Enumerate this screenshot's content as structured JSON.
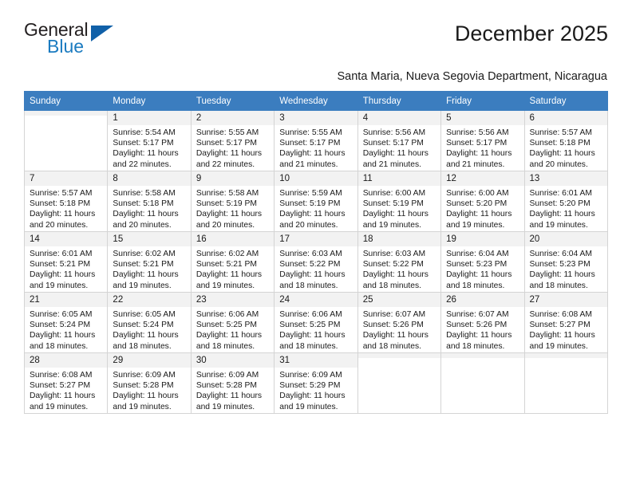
{
  "brand": {
    "name_top": "General",
    "name_bottom": "Blue",
    "triangle_color": "#1060a8",
    "blue_text_color": "#1b7bc0"
  },
  "header": {
    "title": "December 2025",
    "subtitle": "Santa Maria, Nueva Segovia Department, Nicaragua"
  },
  "theme": {
    "header_bg": "#3b7dbf",
    "daynum_bg": "#f2f2f2",
    "grid_border": "#d4d4d4"
  },
  "calendar": {
    "weekdays": [
      "Sunday",
      "Monday",
      "Tuesday",
      "Wednesday",
      "Thursday",
      "Friday",
      "Saturday"
    ],
    "weeks": [
      [
        {
          "day": "",
          "sunrise": "",
          "sunset": "",
          "daylight1": "",
          "daylight2": ""
        },
        {
          "day": "1",
          "sunrise": "Sunrise: 5:54 AM",
          "sunset": "Sunset: 5:17 PM",
          "daylight1": "Daylight: 11 hours",
          "daylight2": "and 22 minutes."
        },
        {
          "day": "2",
          "sunrise": "Sunrise: 5:55 AM",
          "sunset": "Sunset: 5:17 PM",
          "daylight1": "Daylight: 11 hours",
          "daylight2": "and 22 minutes."
        },
        {
          "day": "3",
          "sunrise": "Sunrise: 5:55 AM",
          "sunset": "Sunset: 5:17 PM",
          "daylight1": "Daylight: 11 hours",
          "daylight2": "and 21 minutes."
        },
        {
          "day": "4",
          "sunrise": "Sunrise: 5:56 AM",
          "sunset": "Sunset: 5:17 PM",
          "daylight1": "Daylight: 11 hours",
          "daylight2": "and 21 minutes."
        },
        {
          "day": "5",
          "sunrise": "Sunrise: 5:56 AM",
          "sunset": "Sunset: 5:17 PM",
          "daylight1": "Daylight: 11 hours",
          "daylight2": "and 21 minutes."
        },
        {
          "day": "6",
          "sunrise": "Sunrise: 5:57 AM",
          "sunset": "Sunset: 5:18 PM",
          "daylight1": "Daylight: 11 hours",
          "daylight2": "and 20 minutes."
        }
      ],
      [
        {
          "day": "7",
          "sunrise": "Sunrise: 5:57 AM",
          "sunset": "Sunset: 5:18 PM",
          "daylight1": "Daylight: 11 hours",
          "daylight2": "and 20 minutes."
        },
        {
          "day": "8",
          "sunrise": "Sunrise: 5:58 AM",
          "sunset": "Sunset: 5:18 PM",
          "daylight1": "Daylight: 11 hours",
          "daylight2": "and 20 minutes."
        },
        {
          "day": "9",
          "sunrise": "Sunrise: 5:58 AM",
          "sunset": "Sunset: 5:19 PM",
          "daylight1": "Daylight: 11 hours",
          "daylight2": "and 20 minutes."
        },
        {
          "day": "10",
          "sunrise": "Sunrise: 5:59 AM",
          "sunset": "Sunset: 5:19 PM",
          "daylight1": "Daylight: 11 hours",
          "daylight2": "and 20 minutes."
        },
        {
          "day": "11",
          "sunrise": "Sunrise: 6:00 AM",
          "sunset": "Sunset: 5:19 PM",
          "daylight1": "Daylight: 11 hours",
          "daylight2": "and 19 minutes."
        },
        {
          "day": "12",
          "sunrise": "Sunrise: 6:00 AM",
          "sunset": "Sunset: 5:20 PM",
          "daylight1": "Daylight: 11 hours",
          "daylight2": "and 19 minutes."
        },
        {
          "day": "13",
          "sunrise": "Sunrise: 6:01 AM",
          "sunset": "Sunset: 5:20 PM",
          "daylight1": "Daylight: 11 hours",
          "daylight2": "and 19 minutes."
        }
      ],
      [
        {
          "day": "14",
          "sunrise": "Sunrise: 6:01 AM",
          "sunset": "Sunset: 5:21 PM",
          "daylight1": "Daylight: 11 hours",
          "daylight2": "and 19 minutes."
        },
        {
          "day": "15",
          "sunrise": "Sunrise: 6:02 AM",
          "sunset": "Sunset: 5:21 PM",
          "daylight1": "Daylight: 11 hours",
          "daylight2": "and 19 minutes."
        },
        {
          "day": "16",
          "sunrise": "Sunrise: 6:02 AM",
          "sunset": "Sunset: 5:21 PM",
          "daylight1": "Daylight: 11 hours",
          "daylight2": "and 19 minutes."
        },
        {
          "day": "17",
          "sunrise": "Sunrise: 6:03 AM",
          "sunset": "Sunset: 5:22 PM",
          "daylight1": "Daylight: 11 hours",
          "daylight2": "and 18 minutes."
        },
        {
          "day": "18",
          "sunrise": "Sunrise: 6:03 AM",
          "sunset": "Sunset: 5:22 PM",
          "daylight1": "Daylight: 11 hours",
          "daylight2": "and 18 minutes."
        },
        {
          "day": "19",
          "sunrise": "Sunrise: 6:04 AM",
          "sunset": "Sunset: 5:23 PM",
          "daylight1": "Daylight: 11 hours",
          "daylight2": "and 18 minutes."
        },
        {
          "day": "20",
          "sunrise": "Sunrise: 6:04 AM",
          "sunset": "Sunset: 5:23 PM",
          "daylight1": "Daylight: 11 hours",
          "daylight2": "and 18 minutes."
        }
      ],
      [
        {
          "day": "21",
          "sunrise": "Sunrise: 6:05 AM",
          "sunset": "Sunset: 5:24 PM",
          "daylight1": "Daylight: 11 hours",
          "daylight2": "and 18 minutes."
        },
        {
          "day": "22",
          "sunrise": "Sunrise: 6:05 AM",
          "sunset": "Sunset: 5:24 PM",
          "daylight1": "Daylight: 11 hours",
          "daylight2": "and 18 minutes."
        },
        {
          "day": "23",
          "sunrise": "Sunrise: 6:06 AM",
          "sunset": "Sunset: 5:25 PM",
          "daylight1": "Daylight: 11 hours",
          "daylight2": "and 18 minutes."
        },
        {
          "day": "24",
          "sunrise": "Sunrise: 6:06 AM",
          "sunset": "Sunset: 5:25 PM",
          "daylight1": "Daylight: 11 hours",
          "daylight2": "and 18 minutes."
        },
        {
          "day": "25",
          "sunrise": "Sunrise: 6:07 AM",
          "sunset": "Sunset: 5:26 PM",
          "daylight1": "Daylight: 11 hours",
          "daylight2": "and 18 minutes."
        },
        {
          "day": "26",
          "sunrise": "Sunrise: 6:07 AM",
          "sunset": "Sunset: 5:26 PM",
          "daylight1": "Daylight: 11 hours",
          "daylight2": "and 18 minutes."
        },
        {
          "day": "27",
          "sunrise": "Sunrise: 6:08 AM",
          "sunset": "Sunset: 5:27 PM",
          "daylight1": "Daylight: 11 hours",
          "daylight2": "and 19 minutes."
        }
      ],
      [
        {
          "day": "28",
          "sunrise": "Sunrise: 6:08 AM",
          "sunset": "Sunset: 5:27 PM",
          "daylight1": "Daylight: 11 hours",
          "daylight2": "and 19 minutes."
        },
        {
          "day": "29",
          "sunrise": "Sunrise: 6:09 AM",
          "sunset": "Sunset: 5:28 PM",
          "daylight1": "Daylight: 11 hours",
          "daylight2": "and 19 minutes."
        },
        {
          "day": "30",
          "sunrise": "Sunrise: 6:09 AM",
          "sunset": "Sunset: 5:28 PM",
          "daylight1": "Daylight: 11 hours",
          "daylight2": "and 19 minutes."
        },
        {
          "day": "31",
          "sunrise": "Sunrise: 6:09 AM",
          "sunset": "Sunset: 5:29 PM",
          "daylight1": "Daylight: 11 hours",
          "daylight2": "and 19 minutes."
        },
        {
          "day": "",
          "sunrise": "",
          "sunset": "",
          "daylight1": "",
          "daylight2": ""
        },
        {
          "day": "",
          "sunrise": "",
          "sunset": "",
          "daylight1": "",
          "daylight2": ""
        },
        {
          "day": "",
          "sunrise": "",
          "sunset": "",
          "daylight1": "",
          "daylight2": ""
        }
      ]
    ]
  }
}
